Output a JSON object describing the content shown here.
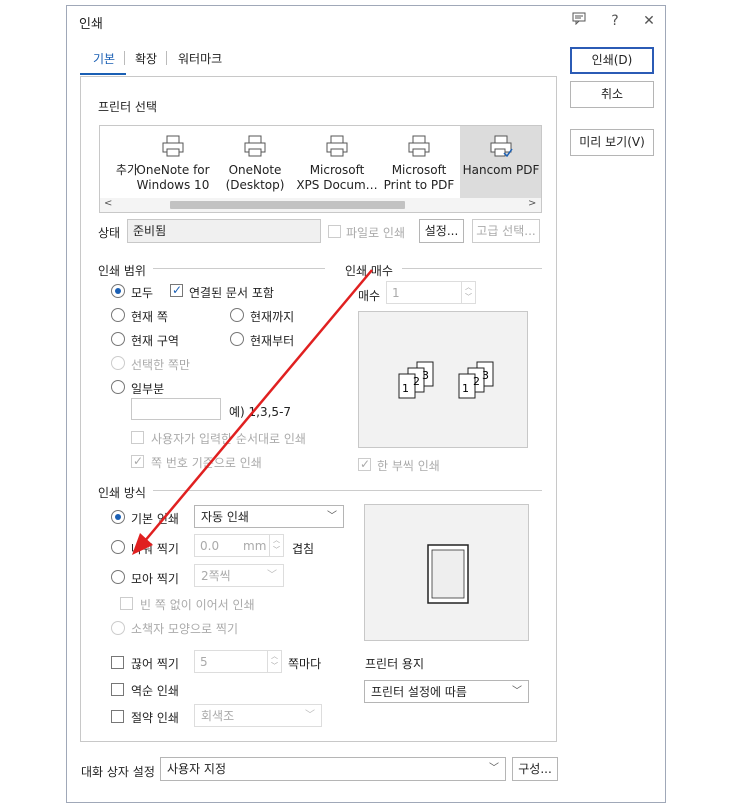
{
  "dialog": {
    "title": "인쇄",
    "tabs": [
      {
        "label": "기본"
      },
      {
        "label": "확장"
      },
      {
        "label": "워터마크"
      }
    ]
  },
  "buttons": {
    "print": "인쇄(D)",
    "cancel": "취소",
    "preview": "미리 보기(V)",
    "settings": "설정...",
    "advanced": "고급 선택...",
    "config": "구성..."
  },
  "printer_select": {
    "title": "프린터 선택",
    "printers": [
      {
        "line1": "추가",
        "line2": ""
      },
      {
        "line1": "OneNote for",
        "line2": "Windows 10"
      },
      {
        "line1": "OneNote",
        "line2": "(Desktop)"
      },
      {
        "line1": "Microsoft",
        "line2": "XPS Docum…"
      },
      {
        "line1": "Microsoft",
        "line2": "Print to PDF"
      },
      {
        "line1": "Hancom PDF",
        "line2": ""
      }
    ],
    "status_label": "상태",
    "status_value": "준비됨",
    "print_to_file": "파일로 인쇄"
  },
  "range": {
    "title": "인쇄 범위",
    "all": "모두",
    "include_linked": "연결된 문서 포함",
    "current_page": "현재 쪽",
    "to_current": "현재까지",
    "current_section": "현재 구역",
    "from_current": "현재부터",
    "selected_pages": "선택한 쪽만",
    "partial": "일부분",
    "partial_example": "예) 1,3,5-7",
    "user_order": "사용자가 입력한 순서대로 인쇄",
    "page_number_based": "쪽 번호 기준으로 인쇄"
  },
  "copies": {
    "title": "인쇄 매수",
    "label": "매수",
    "value": "1",
    "collate": "한 부씩 인쇄",
    "collate_digits": [
      "1",
      "2",
      "3",
      "1",
      "2",
      "3"
    ]
  },
  "method": {
    "title": "인쇄 방식",
    "basic": "기본 인쇄",
    "basic_select": "자동 인쇄",
    "nup": "나눠 찍기",
    "nup_value": "0.0",
    "nup_unit": "mm",
    "overlap": "겹침",
    "collect": "모아 찍기",
    "collect_select": "2쪽씩",
    "no_blank": "빈 쪽 없이 이어서 인쇄",
    "booklet": "소책자 모양으로 찍기",
    "cut": "끊어 찍기",
    "cut_value": "5",
    "cut_unit": "쪽마다",
    "reverse": "역순 인쇄",
    "save": "절약 인쇄",
    "save_select": "회색조"
  },
  "paper": {
    "label": "프린터 용지",
    "select": "프린터 설정에 따름"
  },
  "dialog_settings": {
    "label": "대화 상자 설정",
    "select": "사용자 지정"
  },
  "colors": {
    "accent": "#1a5fb4",
    "annotation_arrow": "#e02020"
  }
}
